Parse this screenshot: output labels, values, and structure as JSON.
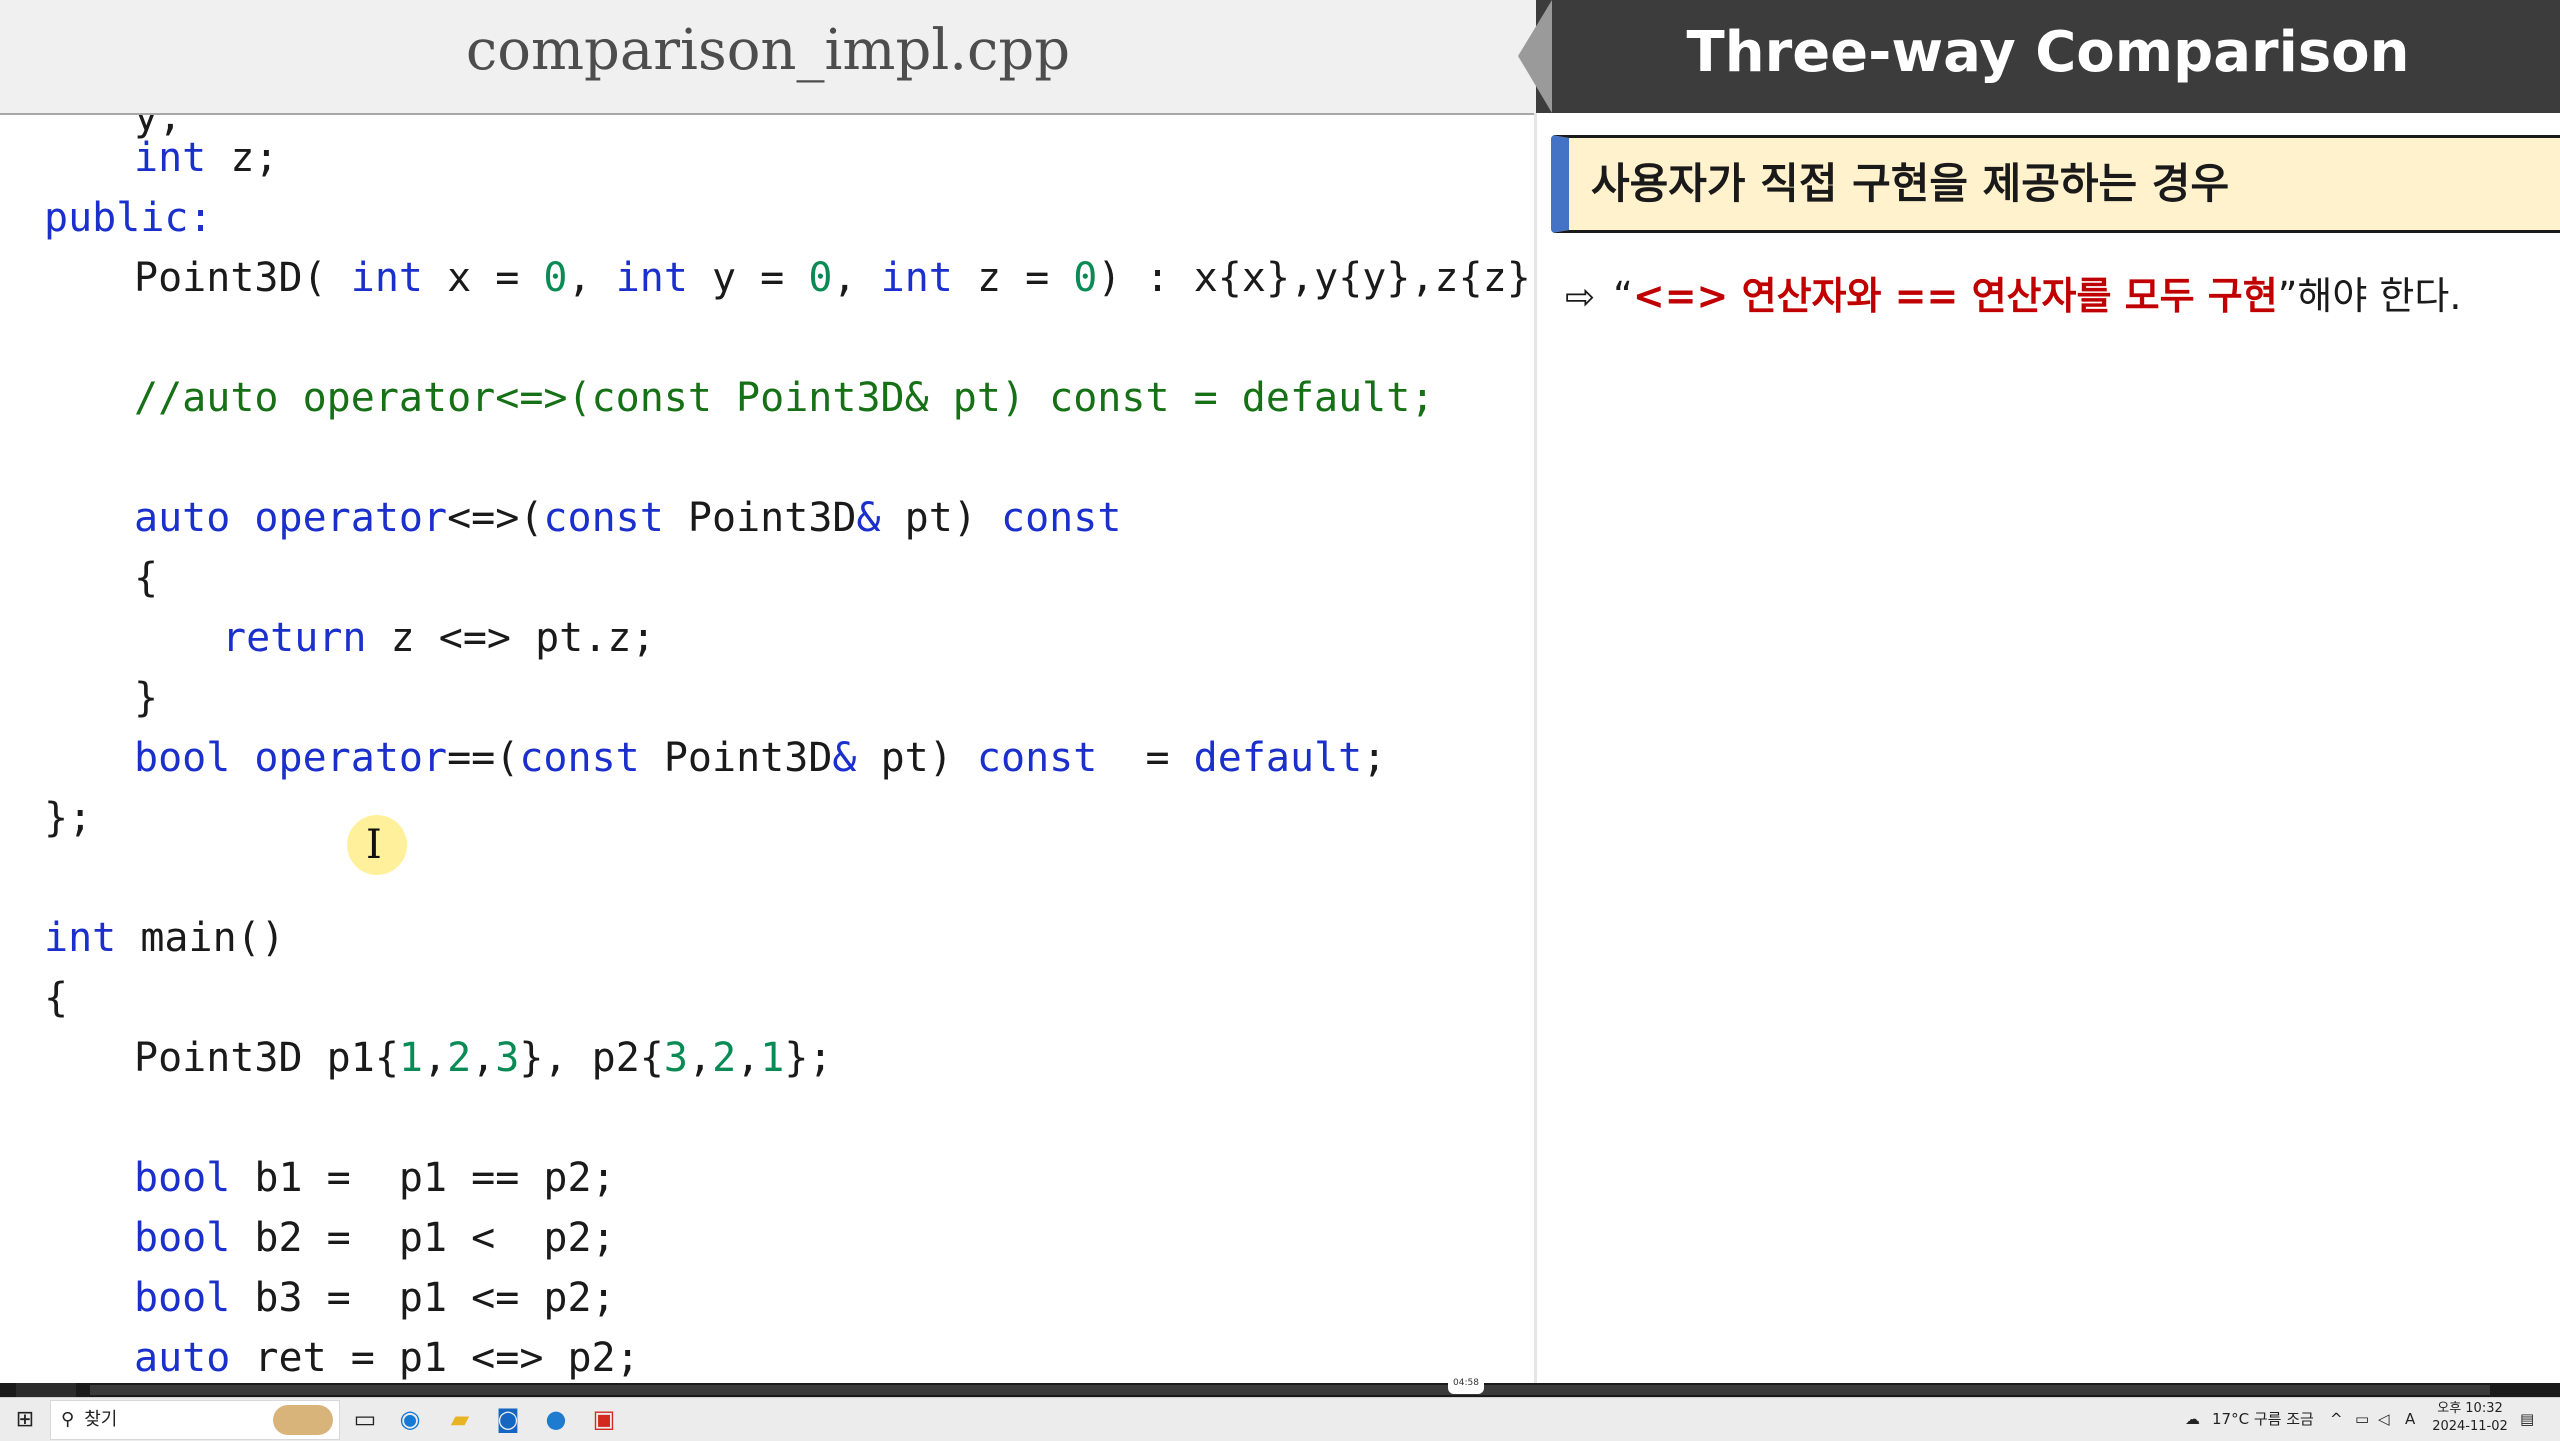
{
  "left_header": {
    "file_name": "comparison_impl.cpp"
  },
  "right_header": {
    "title": "Three-way Comparison"
  },
  "code": {
    "partial_top": "y;",
    "lines": {
      "l1": [
        "int",
        " z;"
      ],
      "l2": [
        "public:"
      ],
      "l3": [
        "Point3D( ",
        "int",
        " x = ",
        "0",
        ", ",
        "int",
        " y = ",
        "0",
        ", ",
        "int",
        " z = ",
        "0",
        ") : x{x},y{y},z{z} {}"
      ],
      "l4": [
        "//auto operator<=>(const Point3D& pt) const = default;"
      ],
      "l5": [
        "auto",
        " ",
        "operator",
        "<=>(",
        "const",
        " Point3D",
        "&",
        " pt) ",
        "const"
      ],
      "l6": [
        "{"
      ],
      "l7": [
        "return",
        " z <=> pt.z;"
      ],
      "l8": [
        "}"
      ],
      "l9": [
        "bool",
        " ",
        "operator",
        "==(",
        "const",
        " Point3D",
        "&",
        " pt) ",
        "const",
        "  = ",
        "default",
        ";"
      ],
      "l10": [
        "};"
      ],
      "l11": [
        "int",
        " main()"
      ],
      "l12": [
        "{"
      ],
      "l13": [
        "Point3D p1{",
        "1",
        ",",
        "2",
        ",",
        "3",
        "}, p2{",
        "3",
        ",",
        "2",
        ",",
        "1",
        "};"
      ],
      "l14": [
        "bool",
        " b1 =  p1 == p2;"
      ],
      "l15": [
        "bool",
        " b2 =  p1 <  p2;"
      ],
      "l16": [
        "bool",
        " b3 =  p1 <= p2;"
      ],
      "l17": [
        "auto",
        " ret = p1 <=> p2;"
      ]
    }
  },
  "slide": {
    "callout_text": "사용자가 직접 구현을 제공하는 경우",
    "bullet_icon": "arrow-right-outline-icon",
    "bullet": {
      "arrow": "⇨",
      "open_quote": "“",
      "emphasis": "<=> 연산자와 == 연산자를 모두 구현",
      "close_quote": "”",
      "tail": "해야 한다."
    }
  },
  "video": {
    "timestamp": "04:58"
  },
  "taskbar": {
    "search_placeholder": "찾기",
    "weather": "17°C 구름 조금",
    "ime": "A",
    "clock_time": "오후 10:32",
    "clock_date": "2024-11-02"
  },
  "colors": {
    "keyword": "#1a2fcc",
    "number": "#0a8a55",
    "comment": "#167016",
    "callout_bg": "#fff2cc",
    "callout_accent": "#4472c4",
    "emphasis_red": "#c00000",
    "header_dark": "#3c3c3c"
  }
}
